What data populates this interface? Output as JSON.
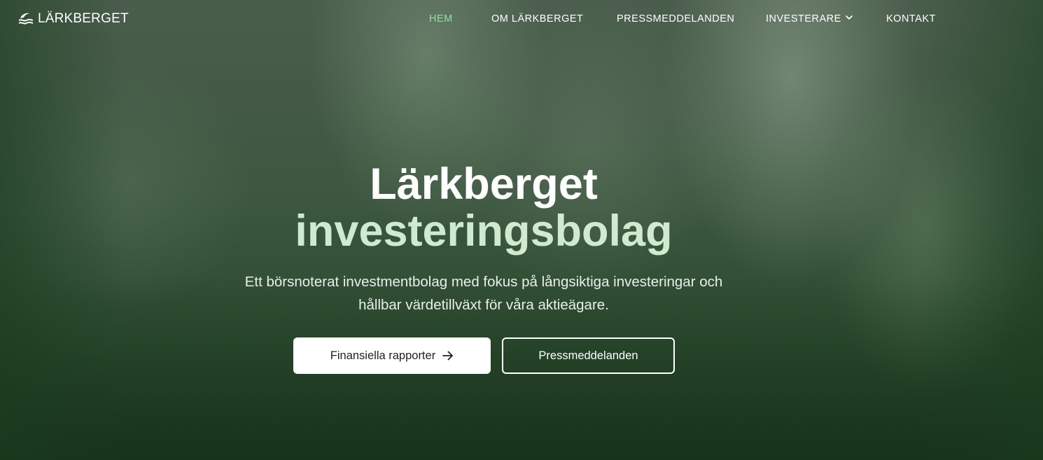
{
  "brand": {
    "name": "LÄRKBERGET",
    "logo_icon": "wave-leaf-icon"
  },
  "nav": {
    "items": [
      {
        "label": "HEM",
        "active": true
      },
      {
        "label": "OM LÄRKBERGET",
        "active": false
      },
      {
        "label": "PRESSMEDDELANDEN",
        "active": false
      },
      {
        "label": "INVESTERARE",
        "active": false,
        "has_dropdown": true,
        "icon": "chevron-down-icon"
      },
      {
        "label": "KONTAKT",
        "active": false
      }
    ]
  },
  "hero": {
    "title_line1": "Lärkberget",
    "title_line2": "investeringsbolag",
    "subtitle_line1": "Ett börsnoterat investmentbolag med fokus på långsiktiga investeringar och",
    "subtitle_line2": "hållbar värdetillväxt för våra aktieägare.",
    "primary_button": {
      "label": "Finansiella rapporter",
      "icon": "arrow-right-icon"
    },
    "secondary_button": {
      "label": "Pressmeddelanden"
    }
  },
  "colors": {
    "accent_active_nav": "#8ee0a6",
    "title_accent": "#cfeacf",
    "background_green": "#2f4a35"
  }
}
